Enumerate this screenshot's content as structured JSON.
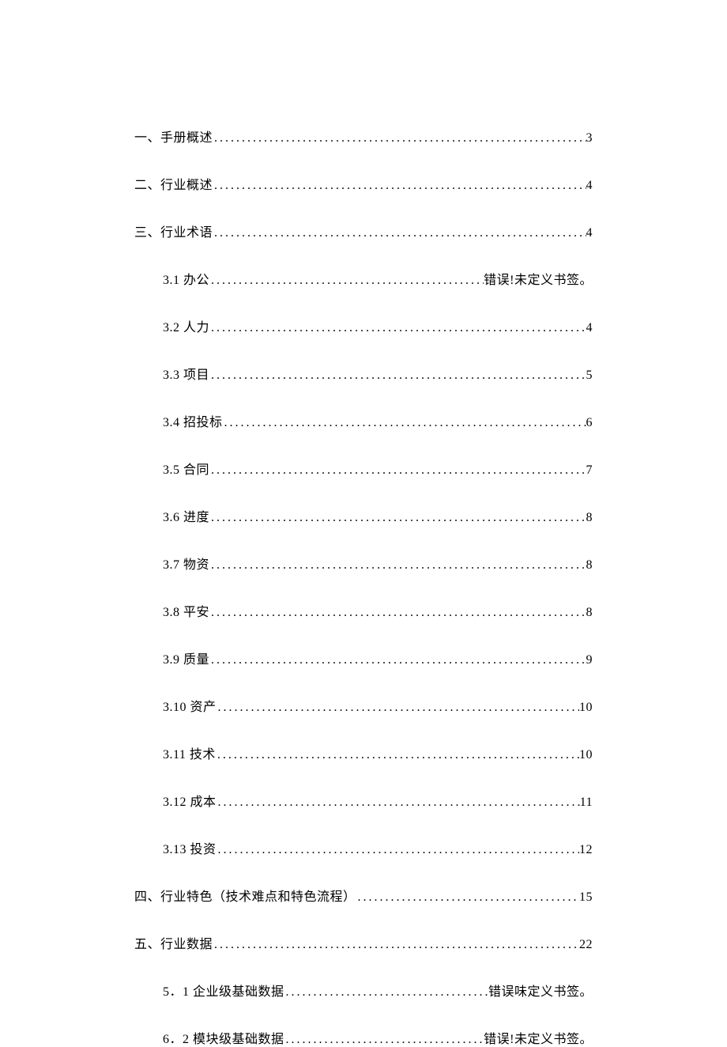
{
  "toc": [
    {
      "label": "一、手册概述",
      "page": "3",
      "sub": false
    },
    {
      "label": "二、行业概述",
      "page": "4",
      "sub": false
    },
    {
      "label": "三、行业术语",
      "page": "4",
      "sub": false
    },
    {
      "label": "3.1 办公",
      "page": "错误!未定义书签。",
      "sub": true
    },
    {
      "label": "3.2 人力",
      "page": "4",
      "sub": true
    },
    {
      "label": "3.3 项目",
      "page": "5",
      "sub": true
    },
    {
      "label": "3.4 招投标",
      "page": "6",
      "sub": true
    },
    {
      "label": "3.5 合同",
      "page": "7",
      "sub": true
    },
    {
      "label": "3.6 进度",
      "page": "8",
      "sub": true
    },
    {
      "label": "3.7 物资",
      "page": "8",
      "sub": true
    },
    {
      "label": "3.8 平安",
      "page": "8",
      "sub": true
    },
    {
      "label": "3.9 质量",
      "page": "9",
      "sub": true
    },
    {
      "label": "3.10  资产 ",
      "page": "10",
      "sub": true
    },
    {
      "label": "3.11  技术 ",
      "page": "10",
      "sub": true
    },
    {
      "label": "3.12  成本 ",
      "page": "11",
      "sub": true
    },
    {
      "label": "3.13  投资 ",
      "page": "12",
      "sub": true
    },
    {
      "label": "四、行业特色（技术难点和特色流程） ",
      "page": "15",
      "sub": false
    },
    {
      "label": "五、行业数据 ",
      "page": "22",
      "sub": false
    },
    {
      "label": "5．1 企业级基础数据",
      "page": "错误味定义书签。",
      "sub": true
    },
    {
      "label": "6．2 模块级基础数据",
      "page": "错误!未定义书签。",
      "sub": true
    }
  ],
  "dots": "...................................................................................................."
}
